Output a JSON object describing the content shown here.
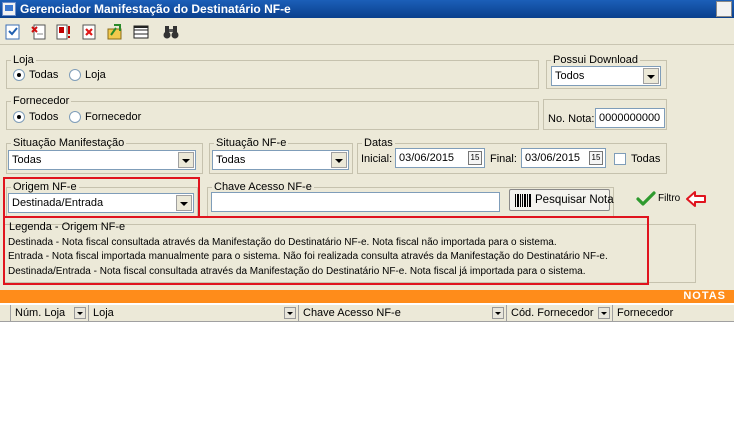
{
  "window": {
    "title": "Gerenciador Manifestação do Destinatário NF-e"
  },
  "toolbar": {
    "icons": [
      "check-list-icon",
      "new-document-icon",
      "alert-document-icon",
      "delete-document-icon",
      "export-icon",
      "grid-view-icon",
      "binoculars-icon"
    ]
  },
  "loja": {
    "legend": "Loja",
    "opt_todas": "Todas",
    "opt_loja": "Loja",
    "selected": "Todas"
  },
  "possui_download": {
    "legend": "Possui Download",
    "value": "Todos"
  },
  "fornecedor": {
    "legend": "Fornecedor",
    "opt_todos": "Todos",
    "opt_fornecedor": "Fornecedor",
    "selected": "Todos"
  },
  "nota": {
    "label": "No. Nota:",
    "value": "0000000000"
  },
  "situacao_manifestacao": {
    "legend": "Situação Manifestação",
    "value": "Todas"
  },
  "situacao_nfe": {
    "legend": "Situação NF-e",
    "value": "Todas"
  },
  "datas": {
    "legend": "Datas",
    "inicial_label": "Inicial:",
    "inicial": "03/06/2015",
    "final_label": "Final:",
    "final": "03/06/2015",
    "cal_text": "15",
    "todas_label": "Todas",
    "todas_checked": false
  },
  "origem": {
    "legend": "Origem NF-e",
    "value": "Destinada/Entrada"
  },
  "chave": {
    "legend": "Chave Acesso NF-e",
    "value": "",
    "button": "Pesquisar Nota"
  },
  "filtro": {
    "label": "Filtro"
  },
  "legenda": {
    "title": "Legenda - Origem NF-e",
    "lines": [
      "Destinada - Nota fiscal consultada através da Manifestação do Destinatário NF-e. Nota fiscal não importada para o sistema.",
      "Entrada - Nota fiscal importada manualmente para o sistema. Não foi realizada consulta através da Manifestação do Destinatário NF-e.",
      "Destinada/Entrada - Nota fiscal consultada através da Manifestação do Destinatário NF-e. Nota fiscal já importada para o sistema."
    ]
  },
  "section": {
    "title": "NOTAS"
  },
  "grid": {
    "columns": [
      "Núm. Loja",
      "Loja",
      "Chave Acesso NF-e",
      "Cód. Fornecedor",
      "Fornecedor"
    ]
  },
  "colors": {
    "accent_red": "#e0141e",
    "banner": "#ff8c1a",
    "check_green": "#2e9a2e"
  }
}
